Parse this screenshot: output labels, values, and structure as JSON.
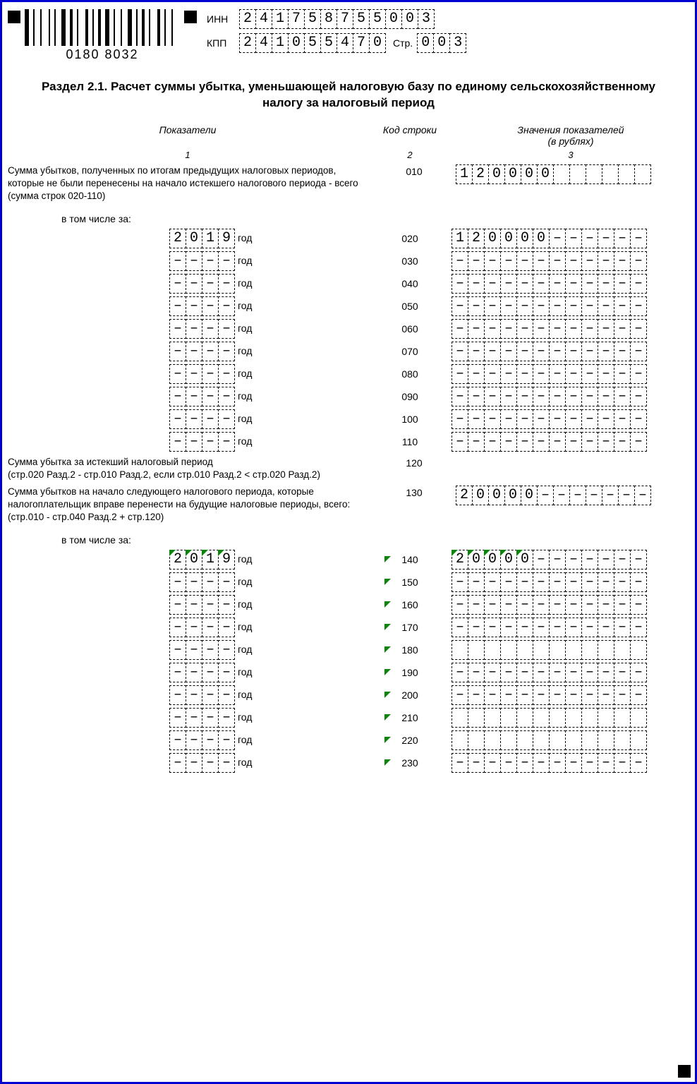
{
  "header": {
    "inn_label": "ИНН",
    "kpp_label": "КПП",
    "str_label": "Стр.",
    "inn": [
      "2",
      "4",
      "1",
      "7",
      "5",
      "8",
      "7",
      "5",
      "5",
      "0",
      "0",
      "3"
    ],
    "kpp": [
      "2",
      "4",
      "1",
      "0",
      "5",
      "5",
      "4",
      "7",
      "0"
    ],
    "page": [
      "0",
      "0",
      "3"
    ],
    "barcode": "0180 8032"
  },
  "title": "Раздел 2.1. Расчет суммы убытка, уменьшающей налоговую базу по единому сельскохозяйственному налогу за налоговый период",
  "cols": {
    "c1": "Показатели",
    "c2": "Код строки",
    "c3": "Значения показателей\n(в рублях)",
    "n1": "1",
    "n2": "2",
    "n3": "3"
  },
  "label_including": "в том числе за:",
  "label_god": "год",
  "row010": {
    "text": "Сумма убытков, полученных по итогам предыдущих налоговых периодов, которые не были перенесены на начало истекшего налогового периода - всего (сумма строк 020-110)",
    "code": "010",
    "val": [
      "1",
      "2",
      "0",
      "0",
      "0",
      "0",
      "",
      "",
      "",
      "",
      "",
      ""
    ]
  },
  "yearsA": [
    {
      "code": "020",
      "year": [
        "2",
        "0",
        "1",
        "9"
      ],
      "val": [
        "1",
        "2",
        "0",
        "0",
        "0",
        "0",
        "–",
        "–",
        "–",
        "–",
        "–",
        "–"
      ]
    },
    {
      "code": "030",
      "year": [
        "–",
        "–",
        "–",
        "–"
      ],
      "val": [
        "–",
        "–",
        "–",
        "–",
        "–",
        "–",
        "–",
        "–",
        "–",
        "–",
        "–",
        "–"
      ]
    },
    {
      "code": "040",
      "year": [
        "–",
        "–",
        "–",
        "–"
      ],
      "val": [
        "–",
        "–",
        "–",
        "–",
        "–",
        "–",
        "–",
        "–",
        "–",
        "–",
        "–",
        "–"
      ]
    },
    {
      "code": "050",
      "year": [
        "–",
        "–",
        "–",
        "–"
      ],
      "val": [
        "–",
        "–",
        "–",
        "–",
        "–",
        "–",
        "–",
        "–",
        "–",
        "–",
        "–",
        "–"
      ]
    },
    {
      "code": "060",
      "year": [
        "–",
        "–",
        "–",
        "–"
      ],
      "val": [
        "–",
        "–",
        "–",
        "–",
        "–",
        "–",
        "–",
        "–",
        "–",
        "–",
        "–",
        "–"
      ]
    },
    {
      "code": "070",
      "year": [
        "–",
        "–",
        "–",
        "–"
      ],
      "val": [
        "–",
        "–",
        "–",
        "–",
        "–",
        "–",
        "–",
        "–",
        "–",
        "–",
        "–",
        "–"
      ]
    },
    {
      "code": "080",
      "year": [
        "–",
        "–",
        "–",
        "–"
      ],
      "val": [
        "–",
        "–",
        "–",
        "–",
        "–",
        "–",
        "–",
        "–",
        "–",
        "–",
        "–",
        "–"
      ]
    },
    {
      "code": "090",
      "year": [
        "–",
        "–",
        "–",
        "–"
      ],
      "val": [
        "–",
        "–",
        "–",
        "–",
        "–",
        "–",
        "–",
        "–",
        "–",
        "–",
        "–",
        "–"
      ]
    },
    {
      "code": "100",
      "year": [
        "–",
        "–",
        "–",
        "–"
      ],
      "val": [
        "–",
        "–",
        "–",
        "–",
        "–",
        "–",
        "–",
        "–",
        "–",
        "–",
        "–",
        "–"
      ]
    },
    {
      "code": "110",
      "year": [
        "–",
        "–",
        "–",
        "–"
      ],
      "val": [
        "–",
        "–",
        "–",
        "–",
        "–",
        "–",
        "–",
        "–",
        "–",
        "–",
        "–",
        "–"
      ]
    }
  ],
  "row120": {
    "text": "Сумма убытка за истекший налоговый период\n(стр.020 Разд.2 - стр.010 Разд.2, если стр.010 Разд.2 < стр.020 Разд.2)",
    "code": "120"
  },
  "row130": {
    "text": "Сумма убытков на начало следующего налогового периода, которые налогоплательщик вправе перенести на будущие налоговые периоды, всего:\n(стр.010 - стр.040 Разд.2 + стр.120)",
    "code": "130",
    "val": [
      "2",
      "0",
      "0",
      "0",
      "0",
      "–",
      "–",
      "–",
      "–",
      "–",
      "–",
      "–"
    ]
  },
  "yearsB": [
    {
      "code": "140",
      "year": [
        "2",
        "0",
        "1",
        "9"
      ],
      "val": [
        "2",
        "0",
        "0",
        "0",
        "0",
        "–",
        "–",
        "–",
        "–",
        "–",
        "–",
        "–"
      ],
      "markY": true,
      "markV": 5
    },
    {
      "code": "150",
      "year": [
        "–",
        "–",
        "–",
        "–"
      ],
      "val": [
        "–",
        "–",
        "–",
        "–",
        "–",
        "–",
        "–",
        "–",
        "–",
        "–",
        "–",
        "–"
      ]
    },
    {
      "code": "160",
      "year": [
        "–",
        "–",
        "–",
        "–"
      ],
      "val": [
        "–",
        "–",
        "–",
        "–",
        "–",
        "–",
        "–",
        "–",
        "–",
        "–",
        "–",
        "–"
      ]
    },
    {
      "code": "170",
      "year": [
        "–",
        "–",
        "–",
        "–"
      ],
      "val": [
        "–",
        "–",
        "–",
        "–",
        "–",
        "–",
        "–",
        "–",
        "–",
        "–",
        "–",
        "–"
      ]
    },
    {
      "code": "180",
      "year": [
        "–",
        "–",
        "–",
        "–"
      ],
      "val": [
        "",
        "",
        "",
        "",
        "",
        "",
        "",
        "",
        "",
        "",
        "",
        ""
      ]
    },
    {
      "code": "190",
      "year": [
        "–",
        "–",
        "–",
        "–"
      ],
      "val": [
        "–",
        "–",
        "–",
        "–",
        "–",
        "–",
        "–",
        "–",
        "–",
        "–",
        "–",
        "–"
      ]
    },
    {
      "code": "200",
      "year": [
        "–",
        "–",
        "–",
        "–"
      ],
      "val": [
        "–",
        "–",
        "–",
        "–",
        "–",
        "–",
        "–",
        "–",
        "–",
        "–",
        "–",
        "–"
      ]
    },
    {
      "code": "210",
      "year": [
        "–",
        "–",
        "–",
        "–"
      ],
      "val": [
        "",
        "",
        "",
        "",
        "",
        "",
        "",
        "",
        "",
        "",
        "",
        ""
      ]
    },
    {
      "code": "220",
      "year": [
        "–",
        "–",
        "–",
        "–"
      ],
      "val": [
        "",
        "",
        "",
        "",
        "",
        "",
        "",
        "",
        "",
        "",
        "",
        ""
      ]
    },
    {
      "code": "230",
      "year": [
        "–",
        "–",
        "–",
        "–"
      ],
      "val": [
        "–",
        "–",
        "–",
        "–",
        "–",
        "–",
        "–",
        "–",
        "–",
        "–",
        "–",
        "–"
      ]
    }
  ]
}
